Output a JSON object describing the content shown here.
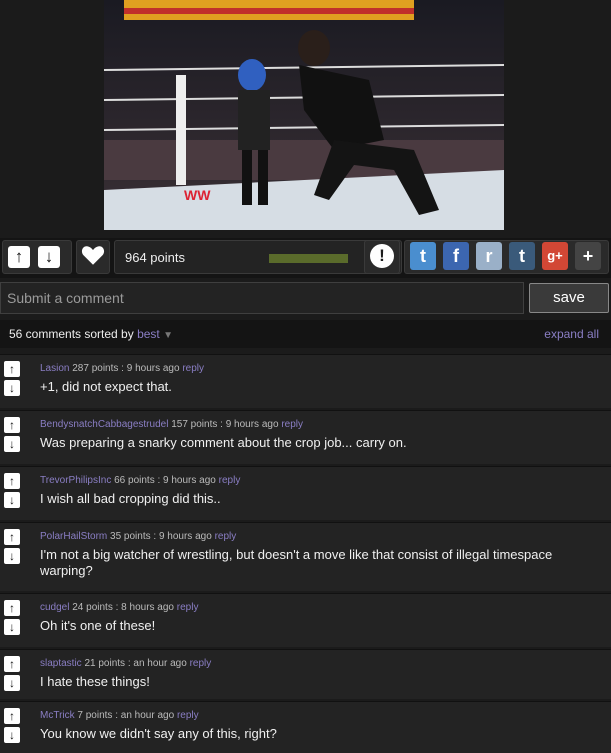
{
  "post": {
    "points_label": "964 points",
    "vote_ratio": 0.9
  },
  "share_icons": [
    {
      "name": "twitter-icon",
      "glyph": "t",
      "color": "#4a8ecf"
    },
    {
      "name": "facebook-icon",
      "glyph": "f",
      "color": "#3c66b0"
    },
    {
      "name": "reddit-icon",
      "glyph": "r",
      "color": "#9ab0c8"
    },
    {
      "name": "tumblr-icon",
      "glyph": "t",
      "color": "#3a5a7a"
    },
    {
      "name": "googleplus-icon",
      "glyph": "g+",
      "color": "#d24735"
    },
    {
      "name": "more-icon",
      "glyph": "+",
      "color": "#444444"
    }
  ],
  "comment_form": {
    "placeholder": "Submit a comment",
    "save_label": "save"
  },
  "sort": {
    "count_label": "56 comments sorted by",
    "sort_value": "best",
    "expand_label": "expand all"
  },
  "comments": [
    {
      "user": "Lasion",
      "meta": "287 points : 9 hours ago",
      "reply": "reply",
      "text": "+1, did not expect that."
    },
    {
      "user": "BendysnatchCabbagestrudel",
      "meta": "157 points : 9 hours ago",
      "reply": "reply",
      "text": "Was preparing a snarky comment about the crop job... carry on."
    },
    {
      "user": "TrevorPhilipsInc",
      "meta": "66 points : 9 hours ago",
      "reply": "reply",
      "text": "I wish all bad cropping did this.."
    },
    {
      "user": "PolarHailStorm",
      "meta": "35 points : 9 hours ago",
      "reply": "reply",
      "text": "I'm not a big watcher of wrestling, but doesn't a move like that consist of illegal timespace warping?"
    },
    {
      "user": "cudgel",
      "meta": "24 points : 8 hours ago",
      "reply": "reply",
      "text": "Oh it's one of these!"
    },
    {
      "user": "slaptastic",
      "meta": "21 points : an hour ago",
      "reply": "reply",
      "text": "I hate these things!"
    },
    {
      "user": "McTrick",
      "meta": "7 points : an hour ago",
      "reply": "reply",
      "text": "You know we didn't say any of this, right?"
    }
  ]
}
